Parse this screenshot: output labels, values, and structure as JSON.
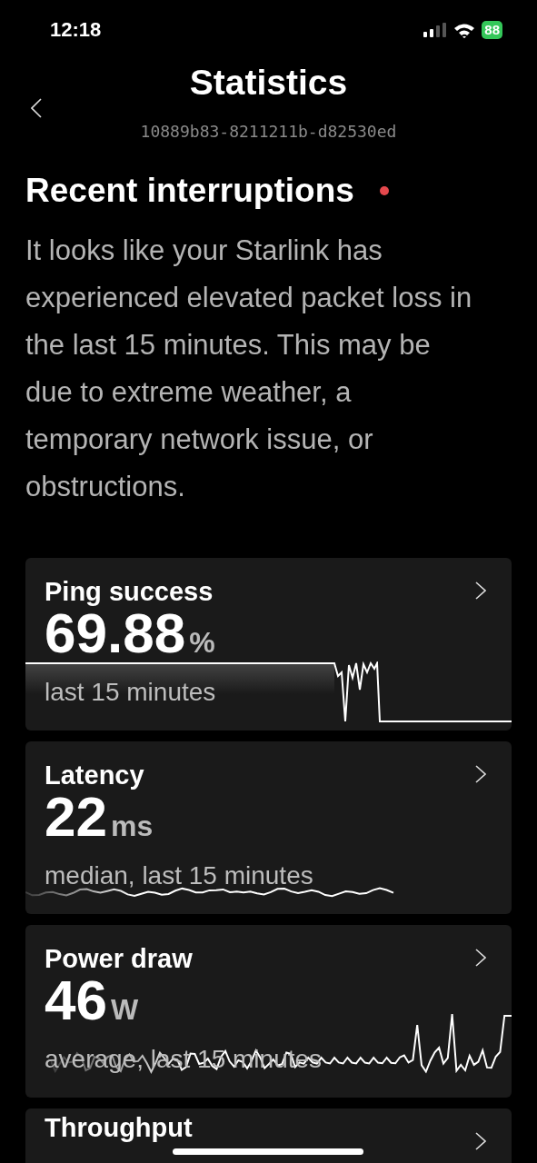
{
  "status_bar": {
    "time": "12:18",
    "battery": "88"
  },
  "header": {
    "title": "Statistics",
    "subtitle": "10889b83-8211211b-d82530ed"
  },
  "alert": {
    "title": "Recent interruptions",
    "message": "It looks like your Starlink has experienced elevated packet loss in the last 15 minutes. This may be due to extreme weather, a temporary network issue, or obstructions."
  },
  "cards": [
    {
      "title": "Ping success",
      "value": "69.88",
      "unit": "%",
      "caption": "last 15 minutes",
      "kind": "step"
    },
    {
      "title": "Latency",
      "value": "22",
      "unit": "ms",
      "caption": "median, last 15 minutes",
      "kind": "flat"
    },
    {
      "title": "Power draw",
      "value": "46",
      "unit": "W",
      "caption": "average, last 15 minutes",
      "kind": "noisy"
    },
    {
      "title": "Throughput",
      "kind": "cut"
    }
  ]
}
